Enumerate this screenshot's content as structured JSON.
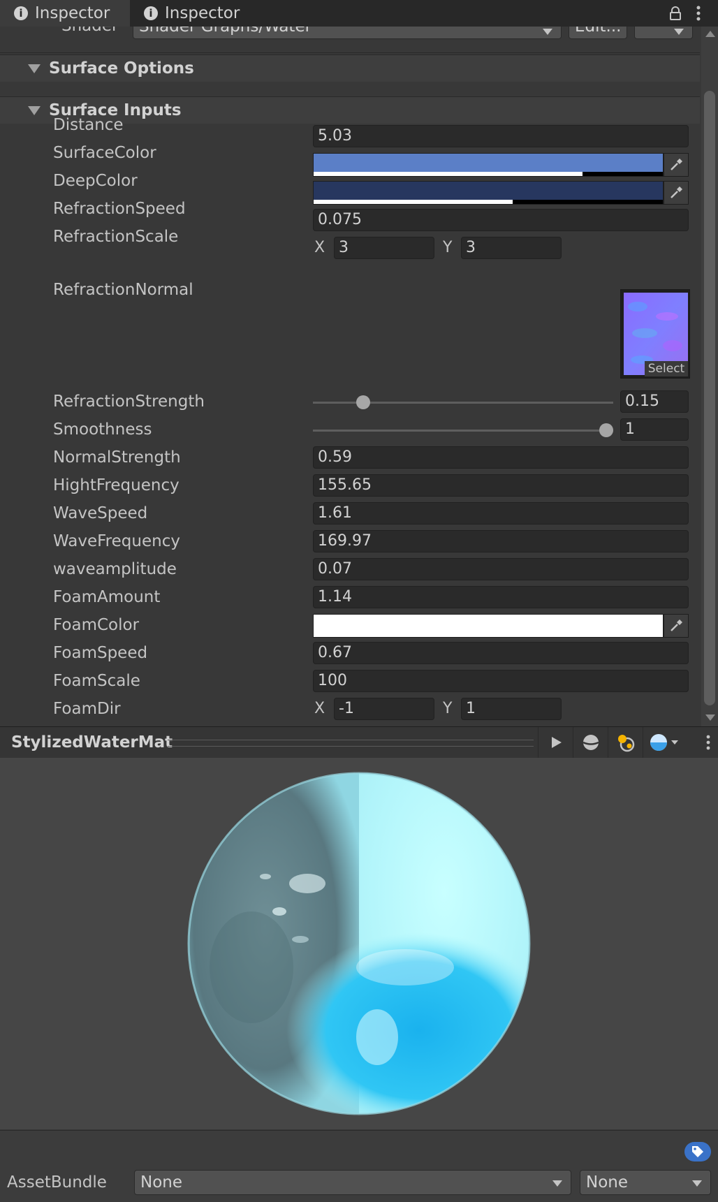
{
  "tabs": [
    {
      "label": "Inspector"
    },
    {
      "label": "Inspector"
    }
  ],
  "shader_row": {
    "label": "Shader",
    "value": "Shader Graphs/Water",
    "edit_label": "Edit..."
  },
  "sections": {
    "surface_options": "Surface Options",
    "surface_inputs": "Surface Inputs"
  },
  "props": {
    "distance": {
      "label": "Distance",
      "value": "5.03"
    },
    "surface_color": {
      "label": "SurfaceColor",
      "color": "#5b7fc7",
      "alpha": 0.77
    },
    "deep_color": {
      "label": "DeepColor",
      "color": "#27375f",
      "alpha": 0.57
    },
    "refraction_speed": {
      "label": "RefractionSpeed",
      "value": "0.075"
    },
    "refraction_scale": {
      "label": "RefractionScale",
      "x": "3",
      "y": "3"
    },
    "refraction_normal": {
      "label": "RefractionNormal",
      "select_label": "Select"
    },
    "refraction_strength": {
      "label": "RefractionStrength",
      "value": "0.15",
      "fraction": 0.15
    },
    "smoothness": {
      "label": "Smoothness",
      "value": "1",
      "fraction": 1.0
    },
    "normal_strength": {
      "label": "NormalStrength",
      "value": "0.59"
    },
    "hight_frequency": {
      "label": "HightFrequency",
      "value": "155.65"
    },
    "wave_speed": {
      "label": "WaveSpeed",
      "value": "1.61"
    },
    "wave_frequency": {
      "label": "WaveFrequency",
      "value": "169.97"
    },
    "wave_amplitude": {
      "label": "waveamplitude",
      "value": "0.07"
    },
    "foam_amount": {
      "label": "FoamAmount",
      "value": "1.14"
    },
    "foam_color": {
      "label": "FoamColor",
      "color": "#ffffff"
    },
    "foam_speed": {
      "label": "FoamSpeed",
      "value": "0.67"
    },
    "foam_scale": {
      "label": "FoamScale",
      "value": "100"
    },
    "foam_dir": {
      "label": "FoamDir",
      "x": "-1",
      "y": "1"
    }
  },
  "axis": {
    "x": "X",
    "y": "Y"
  },
  "preview": {
    "title": "StylizedWaterMat"
  },
  "assetbundle": {
    "label": "AssetBundle",
    "name": "None",
    "variant": "None"
  }
}
